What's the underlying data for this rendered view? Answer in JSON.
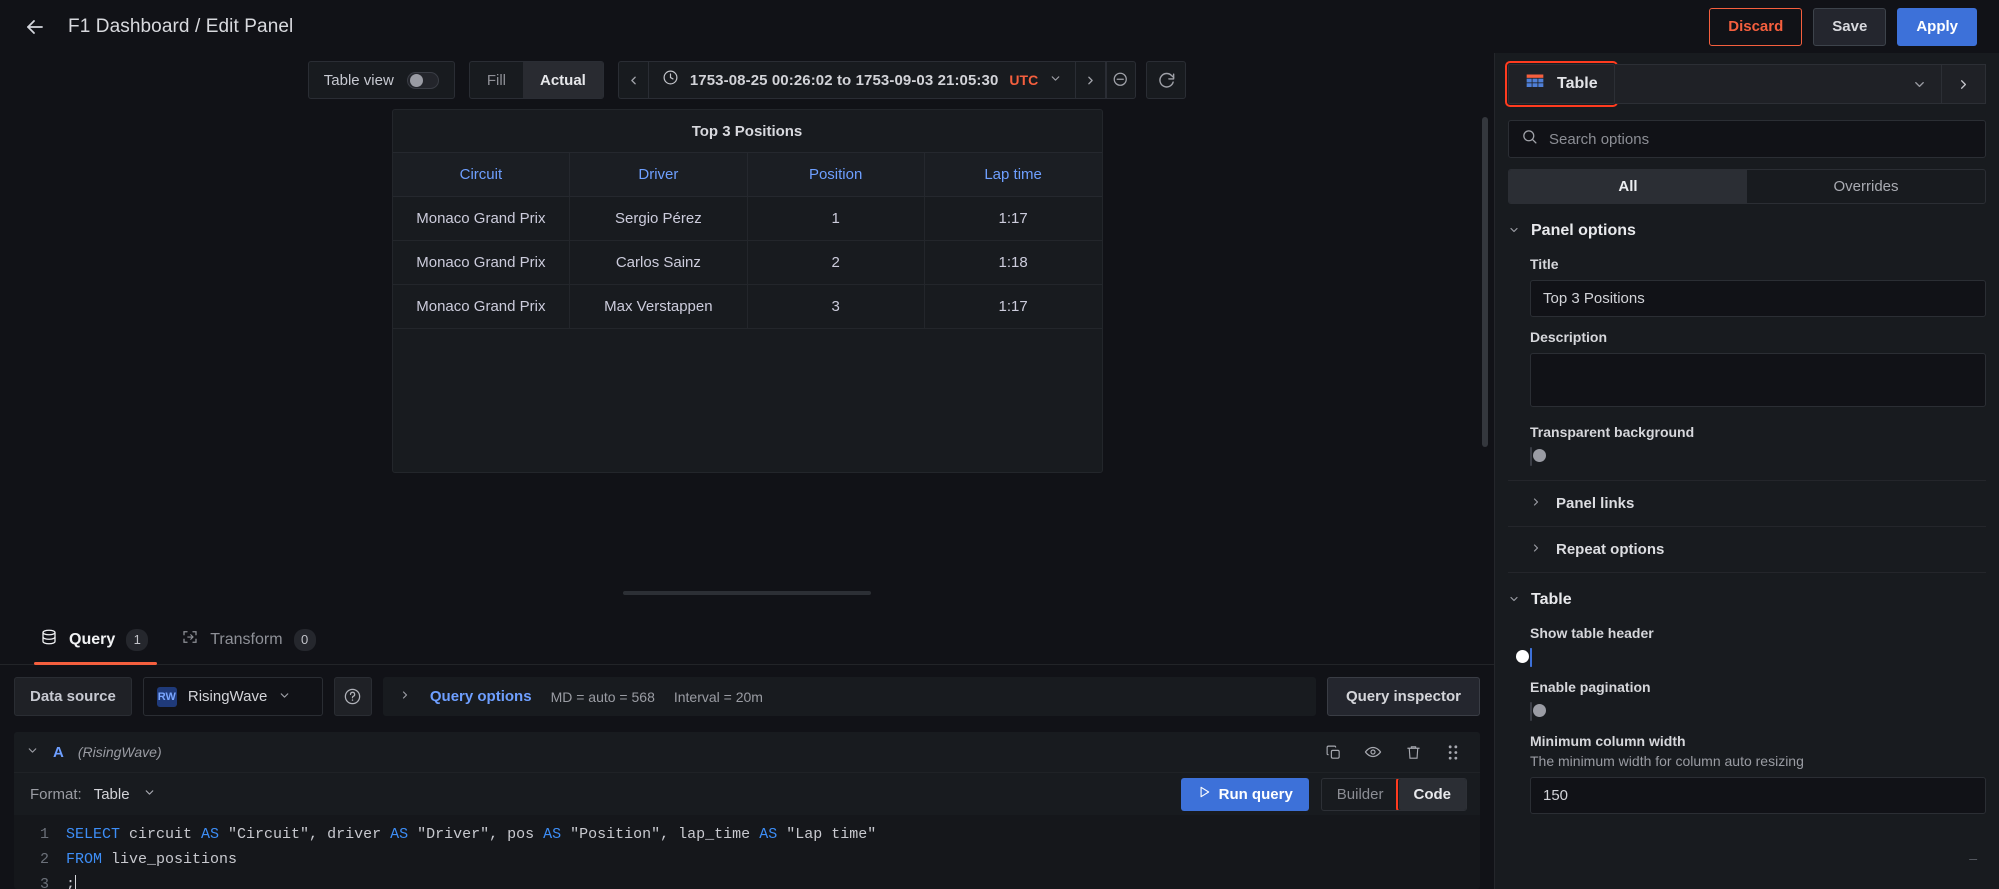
{
  "header": {
    "back_icon": "arrow-left-icon",
    "title": "F1 Dashboard / Edit Panel",
    "discard_label": "Discard",
    "save_label": "Save",
    "apply_label": "Apply",
    "discard_color": "#f55f3e",
    "apply_color": "#3d71d9"
  },
  "toolbar": {
    "table_view_label": "Table view",
    "table_view_on": false,
    "fill_label": "Fill",
    "actual_label": "Actual",
    "actual_active": true,
    "time_range": "1753-08-25 00:26:02 to 1753-09-03 21:05:30",
    "timezone": "UTC",
    "timezone_color": "#f55f3e",
    "prev_icon": "chevron-left-icon",
    "next_icon": "chevron-right-icon",
    "clock_icon": "clock-icon",
    "zoom_out_icon": "zoom-out-icon",
    "refresh_icon": "refresh-icon"
  },
  "panel": {
    "title": "Top 3 Positions",
    "columns": [
      "Circuit",
      "Driver",
      "Position",
      "Lap time"
    ],
    "rows": [
      [
        "Monaco Grand Prix",
        "Sergio Pérez",
        "1",
        "1:17"
      ],
      [
        "Monaco Grand Prix",
        "Carlos Sainz",
        "2",
        "1:18"
      ],
      [
        "Monaco Grand Prix",
        "Max Verstappen",
        "3",
        "1:17"
      ]
    ],
    "header_color": "#6e9fff"
  },
  "query_section": {
    "tabs": [
      {
        "label": "Query",
        "count": "1",
        "icon": "database-icon",
        "active": true
      },
      {
        "label": "Transform",
        "count": "0",
        "icon": "transform-icon",
        "active": false
      }
    ],
    "datasource_label": "Data source",
    "datasource_name": "RisingWave",
    "datasource_logo_text": "RW",
    "help_icon": "question-circle-icon",
    "query_options_label": "Query options",
    "query_options_md": "MD = auto = 568",
    "query_options_interval": "Interval = 20m",
    "query_inspector_label": "Query inspector"
  },
  "query_row": {
    "ref_id": "A",
    "datasource_hint": "(RisingWave)",
    "actions": [
      "copy-icon",
      "eye-icon",
      "trash-icon",
      "drag-handle-icon"
    ],
    "format_label": "Format:",
    "format_value": "Table",
    "run_query_label": "Run query",
    "builder_label": "Builder",
    "code_label": "Code",
    "code_active": true,
    "code_highlighted": true,
    "sql_lines": [
      {
        "num": "1",
        "text": "SELECT circuit AS \"Circuit\", driver AS \"Driver\", pos AS \"Position\", lap_time AS \"Lap time\""
      },
      {
        "num": "2",
        "text": "FROM live_positions"
      },
      {
        "num": "3",
        "text": ";"
      }
    ]
  },
  "options_pane": {
    "viz_name": "Table",
    "viz_icon": "table-icon",
    "viz_highlighted": true,
    "viz_caret_icon": "chevron-down-icon",
    "viz_next_icon": "chevron-right-icon",
    "search_placeholder": "Search options",
    "search_value": "",
    "search_icon": "search-icon",
    "segments": [
      {
        "label": "All",
        "active": true
      },
      {
        "label": "Overrides",
        "active": false
      }
    ],
    "panel_options": {
      "group_title": "Panel options",
      "title_label": "Title",
      "title_value": "Top 3 Positions",
      "description_label": "Description",
      "description_value": "",
      "transparent_label": "Transparent background",
      "transparent_on": false,
      "panel_links_label": "Panel links",
      "repeat_options_label": "Repeat options"
    },
    "table_options": {
      "group_title": "Table",
      "show_header_label": "Show table header",
      "show_header_on": true,
      "pagination_label": "Enable pagination",
      "pagination_on": false,
      "min_width_label": "Minimum column width",
      "min_width_desc": "The minimum width for column auto resizing",
      "min_width_value": "150"
    }
  }
}
